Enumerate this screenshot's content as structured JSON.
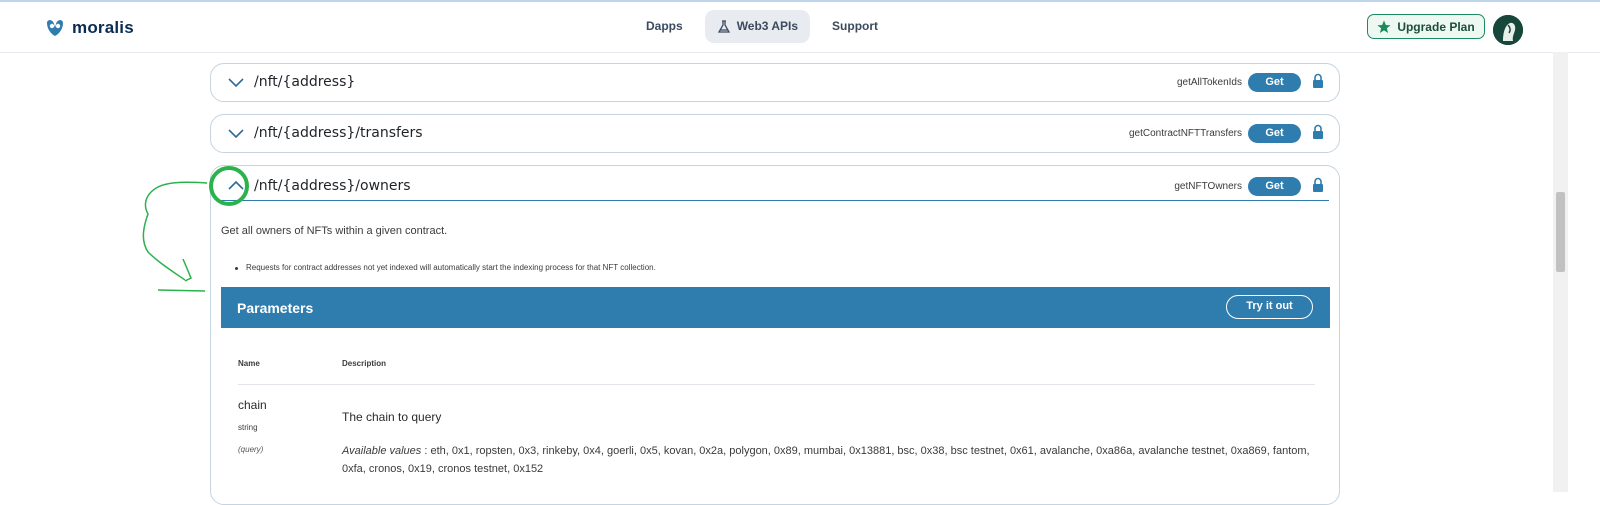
{
  "header": {
    "logo_text": "moralis",
    "nav": [
      {
        "label": "Dapps",
        "active": false
      },
      {
        "label": "Web3 APIs",
        "active": true,
        "icon": "flask-icon"
      },
      {
        "label": "Support",
        "active": false
      }
    ],
    "upgrade_label": "Upgrade Plan",
    "upgrade_icon": "star-icon"
  },
  "endpoints": [
    {
      "path": "/nft/{address}",
      "operation": "getAllTokenIds",
      "method": "Get",
      "expanded": false
    },
    {
      "path": "/nft/{address}/transfers",
      "operation": "getContractNFTTransfers",
      "method": "Get",
      "expanded": false
    },
    {
      "path": "/nft/{address}/owners",
      "operation": "getNFTOwners",
      "method": "Get",
      "expanded": true
    }
  ],
  "expanded": {
    "description": "Get all owners of NFTs within a given contract.",
    "bullet": "Requests for contract addresses not yet indexed will automatically start the indexing process for that NFT collection.",
    "parameters_title": "Parameters",
    "try_it_out": "Try it out",
    "columns": {
      "name": "Name",
      "description": "Description"
    },
    "params": [
      {
        "name": "chain",
        "type": "string",
        "in": "(query)",
        "description": "The chain to query",
        "available_label": "Available values",
        "available_values": ": eth, 0x1, ropsten, 0x3, rinkeby, 0x4, goerli, 0x5, kovan, 0x2a, polygon, 0x89, mumbai, 0x13881, bsc, 0x38, bsc testnet, 0x61, avalanche, 0xa86a, avalanche testnet, 0xa869, fantom, 0xfa, cronos, 0x19, cronos testnet, 0x152"
      }
    ]
  },
  "colors": {
    "accent": "#2f7dae",
    "brand_dark": "#0a2b52",
    "upgrade_border": "#1d8a5e",
    "annotation": "#2bb24c"
  }
}
